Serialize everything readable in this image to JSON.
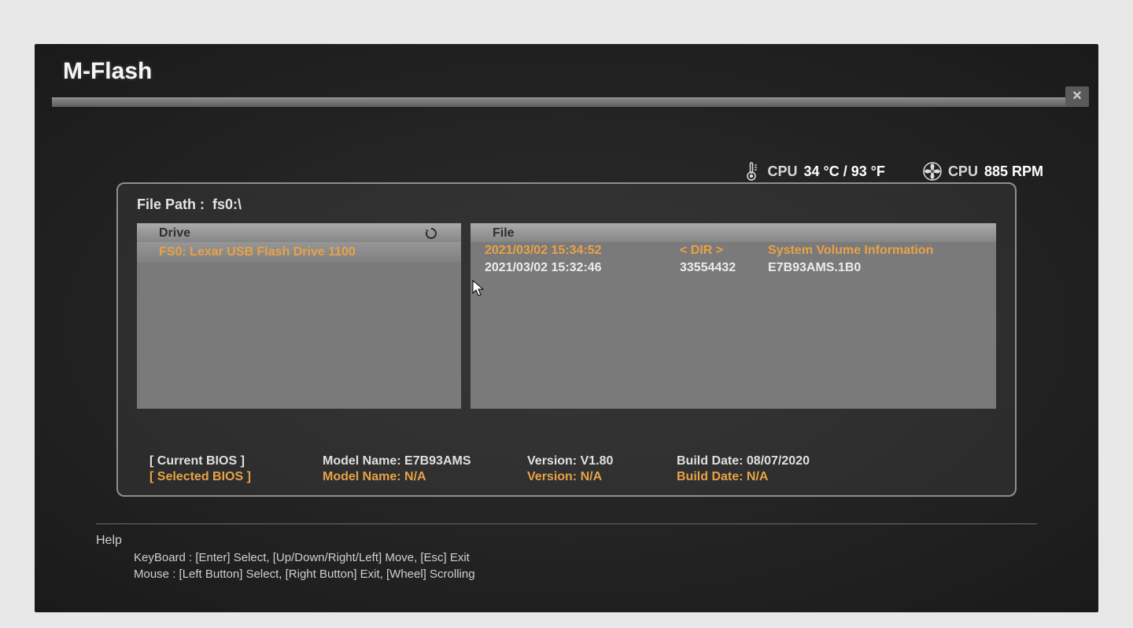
{
  "title": "M-Flash",
  "status": {
    "cpu_temp_label": "CPU",
    "cpu_temp_value": "34 °C / 93 °F",
    "cpu_fan_label": "CPU",
    "cpu_fan_value": "885 RPM"
  },
  "file_path_label": "File Path :",
  "file_path_value": "fs0:\\",
  "columns": {
    "drive_header": "Drive",
    "file_header": "File"
  },
  "drives": [
    {
      "label": "FS0: Lexar USB Flash Drive 1100",
      "selected": true
    }
  ],
  "files": [
    {
      "datetime": "2021/03/02 15:34:52",
      "size": "< DIR >",
      "name": "System Volume Information",
      "selected": true
    },
    {
      "datetime": "2021/03/02 15:32:46",
      "size": "33554432",
      "name": "E7B93AMS.1B0",
      "selected": false
    }
  ],
  "bios": {
    "current_label": "[ Current BIOS ]",
    "selected_label": "[ Selected BIOS ]",
    "current": {
      "model": "Model Name: E7B93AMS",
      "version": "Version: V1.80",
      "build": "Build Date: 08/07/2020"
    },
    "selected": {
      "model": "Model Name: N/A",
      "version": "Version: N/A",
      "build": "Build Date: N/A"
    }
  },
  "help": {
    "title": "Help",
    "keyboard": "KeyBoard :   [Enter]  Select,    [Up/Down/Right/Left]  Move,    [Esc]  Exit",
    "mouse": "Mouse      :   [Left Button]  Select,    [Right Button]  Exit,    [Wheel]  Scrolling"
  }
}
